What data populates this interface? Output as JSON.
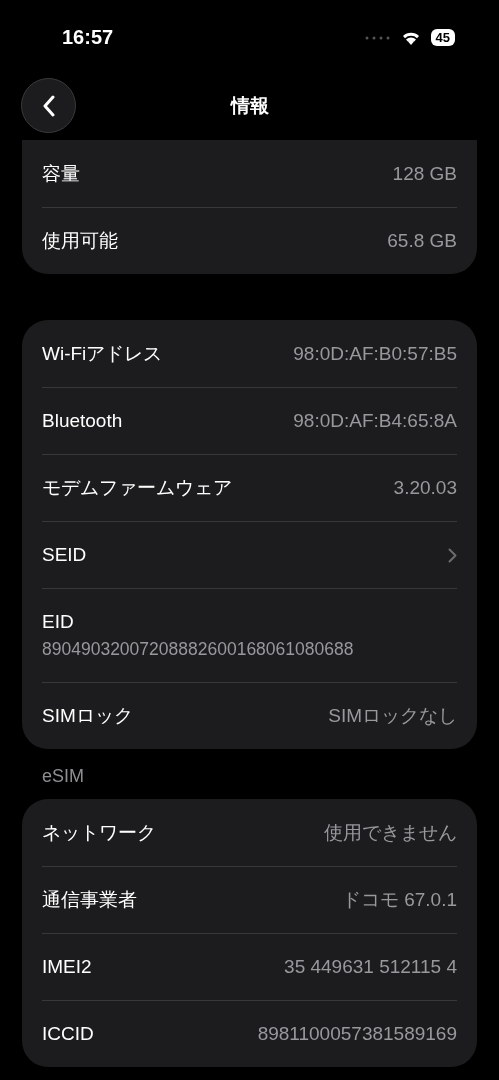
{
  "status_bar": {
    "time": "16:57",
    "battery": "45"
  },
  "nav": {
    "title": "情報"
  },
  "sections": [
    {
      "rows": [
        {
          "kind": "value",
          "label": "容量",
          "value": "128 GB"
        },
        {
          "kind": "value",
          "label": "使用可能",
          "value": "65.8 GB"
        }
      ]
    },
    {
      "rows": [
        {
          "kind": "value",
          "label": "Wi-Fiアドレス",
          "value": "98:0D:AF:B0:57:B5"
        },
        {
          "kind": "value",
          "label": "Bluetooth",
          "value": "98:0D:AF:B4:65:8A"
        },
        {
          "kind": "value",
          "label": "モデムファームウェア",
          "value": "3.20.03"
        },
        {
          "kind": "chevron",
          "label": "SEID"
        },
        {
          "kind": "stacked",
          "label": "EID",
          "value": "89049032007208882600168061080688"
        },
        {
          "kind": "value",
          "label": "SIMロック",
          "value": "SIMロックなし"
        }
      ]
    },
    {
      "header": "eSIM",
      "rows": [
        {
          "kind": "value",
          "label": "ネットワーク",
          "value": "使用できません"
        },
        {
          "kind": "value",
          "label": "通信事業者",
          "value": "ドコモ 67.0.1"
        },
        {
          "kind": "value",
          "label": "IMEI2",
          "value": "35 449631 512115 4"
        },
        {
          "kind": "value",
          "label": "ICCID",
          "value": "8981100057381589169"
        }
      ]
    }
  ]
}
